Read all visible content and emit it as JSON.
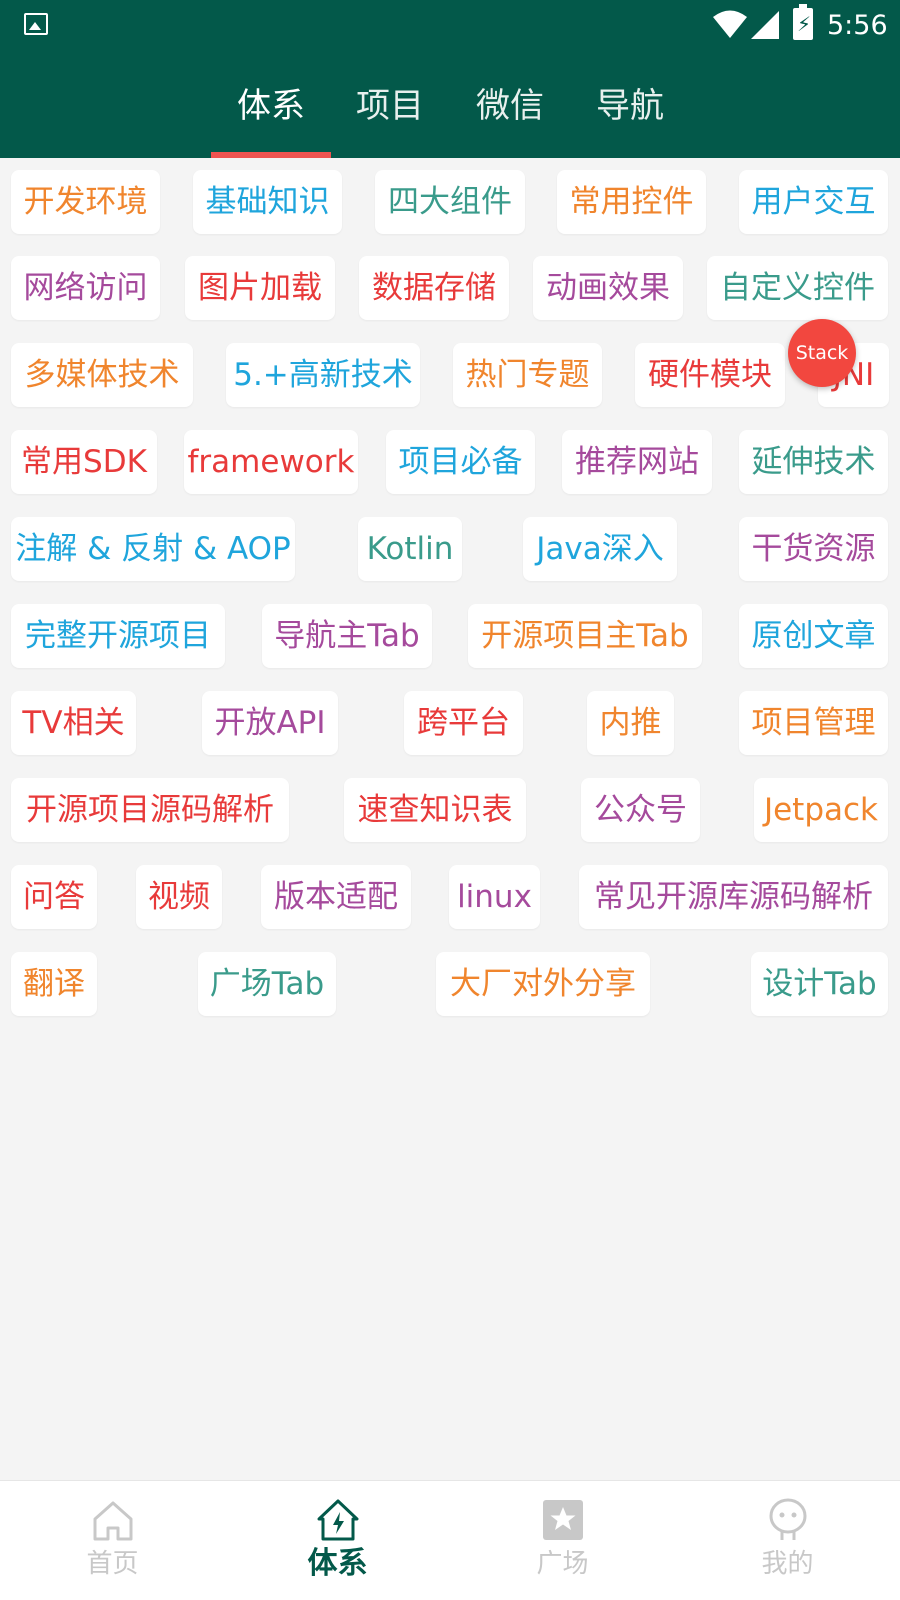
{
  "status_bar": {
    "time": "5:56",
    "battery_glyph": "⚡"
  },
  "top_tabs": [
    {
      "label": "体系",
      "active": true
    },
    {
      "label": "项目",
      "active": false
    },
    {
      "label": "微信",
      "active": false
    },
    {
      "label": "导航",
      "active": false
    }
  ],
  "accent_colors": {
    "header": "#03594a",
    "indicator": "#ef5350"
  },
  "tag_rows": [
    [
      "开发环境",
      "基础知识",
      "四大组件",
      "常用控件",
      "用户交互"
    ],
    [
      "网络访问",
      "图片加载",
      "数据存储",
      "动画效果",
      "自定义控件"
    ],
    [
      "多媒体技术",
      "5.+高新技术",
      "热门专题",
      "硬件模块",
      "JNI"
    ],
    [
      "常用SDK",
      "framework",
      "项目必备",
      "推荐网站",
      "延伸技术"
    ],
    [
      "注解 & 反射 & AOP",
      "Kotlin",
      "Java深入",
      "干货资源"
    ],
    [
      "完整开源项目",
      "导航主Tab",
      "开源项目主Tab",
      "原创文章"
    ],
    [
      "TV相关",
      "开放API",
      "跨平台",
      "内推",
      "项目管理"
    ],
    [
      "开源项目源码解析",
      "速查知识表",
      "公众号",
      "Jetpack"
    ],
    [
      "问答",
      "视频",
      "版本适配",
      "linux",
      "常见开源库源码解析"
    ],
    [
      "翻译",
      "广场Tab",
      "大厂对外分享",
      "设计Tab"
    ]
  ],
  "tag_colors": [
    "#f0852d",
    "#1fa5dc",
    "#3a9b8b",
    "#a54a9c",
    "#e83a3a"
  ],
  "floating_bubble": {
    "label": "Stack"
  },
  "bottom_nav": [
    {
      "label": "首页",
      "icon": "home-icon",
      "active": false
    },
    {
      "label": "体系",
      "icon": "system-icon",
      "active": true
    },
    {
      "label": "广场",
      "icon": "square-icon",
      "active": false
    },
    {
      "label": "我的",
      "icon": "profile-icon",
      "active": false
    }
  ]
}
